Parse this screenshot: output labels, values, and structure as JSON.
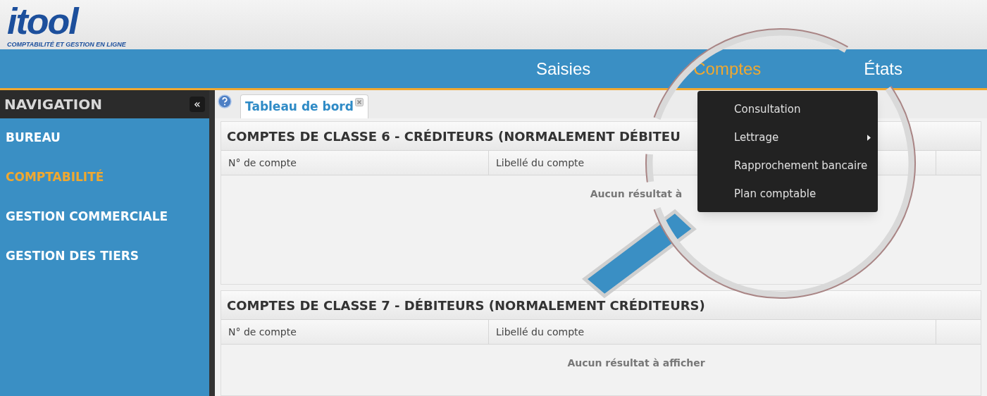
{
  "logo": {
    "wordmark": "itool",
    "tagline": "COMPTABILITÉ ET GESTION EN LIGNE"
  },
  "menu_bar": [
    {
      "label": "Saisies",
      "selected": false
    },
    {
      "label": "Comptes",
      "selected": true
    },
    {
      "label": "États",
      "selected": false
    }
  ],
  "dropdown": [
    {
      "label": "Consultation",
      "has_submenu": false
    },
    {
      "label": "Lettrage",
      "has_submenu": true
    },
    {
      "label": "Rapprochement bancaire",
      "has_submenu": false
    },
    {
      "label": "Plan comptable",
      "has_submenu": false
    }
  ],
  "sidebar": {
    "title": "NAVIGATION",
    "collapse": "«",
    "items": [
      {
        "label": "BUREAU",
        "selected": false
      },
      {
        "label": "COMPTABILITÉ",
        "selected": true
      },
      {
        "label": "GESTION COMMERCIALE",
        "selected": false
      },
      {
        "label": "GESTION DES TIERS",
        "selected": false
      }
    ]
  },
  "tabs": [
    {
      "label": "Tableau de bord",
      "selected": true
    }
  ],
  "panels": [
    {
      "title": "COMPTES DE CLASSE 6 - CRÉDITEURS (NORMALEMENT DÉBITEU",
      "columns": [
        "N° de compte",
        "Libellé du compte"
      ],
      "empty_message": "Aucun résultat à"
    },
    {
      "title": "COMPTES DE CLASSE 7 - DÉBITEURS (NORMALEMENT CRÉDITEURS)",
      "columns": [
        "N° de compte",
        "Libellé du compte"
      ],
      "empty_message": "Aucun résultat à afficher"
    }
  ]
}
